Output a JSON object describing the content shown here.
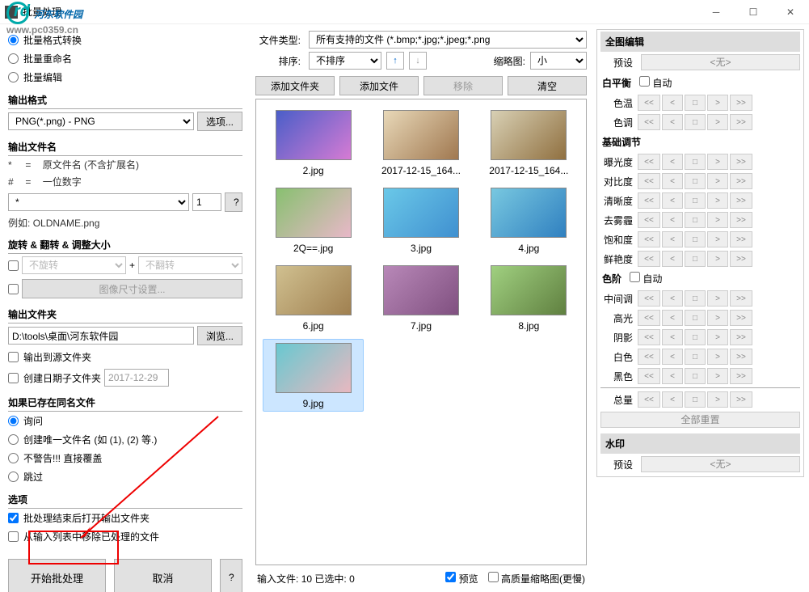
{
  "title": "批量处理",
  "watermark": {
    "main": "河东软件园",
    "sub": "www.pc0359.cn"
  },
  "left": {
    "mode": {
      "convert": "批量格式转换",
      "rename": "批量重命名",
      "edit": "批量编辑",
      "selected": "convert"
    },
    "outputFormat": {
      "title": "输出格式",
      "value": "PNG(*.png) - PNG",
      "optionsBtn": "选项..."
    },
    "outputName": {
      "title": "输出文件名",
      "hint1_sym": "*",
      "hint1_eq": "=",
      "hint1": "原文件名 (不含扩展名)",
      "hint2_sym": "#",
      "hint2_eq": "=",
      "hint2": "一位数字",
      "pattern": "*",
      "number": "1",
      "example_label": "例如:",
      "example": "OLDNAME.png"
    },
    "rotate": {
      "title": "旋转 & 翻转 & 调整大小",
      "rotateVal": "不旋转",
      "plus": "+",
      "flipVal": "不翻转",
      "sizeBtn": "图像尺寸设置..."
    },
    "outFolder": {
      "title": "输出文件夹",
      "path": "D:\\tools\\桌面\\河东软件园",
      "browse": "浏览...",
      "toSource": "输出到源文件夹",
      "dateFolder": "创建日期子文件夹",
      "dateVal": "2017-12-29"
    },
    "ifExists": {
      "title": "如果已存在同名文件",
      "ask": "询问",
      "unique": "创建唯一文件名 (如 (1), (2) 等.)",
      "overwrite": "不警告!!! 直接覆盖",
      "skip": "跳过"
    },
    "options": {
      "title": "选项",
      "openAfter": "批处理结束后打开输出文件夹",
      "removeDone": "从输入列表中移除已处理的文件"
    },
    "buttons": {
      "start": "开始批处理",
      "cancel": "取消",
      "help": "?"
    }
  },
  "mid": {
    "fileTypeLabel": "文件类型:",
    "fileTypeValue": "所有支持的文件 (*.bmp;*.jpg;*.jpeg;*.png",
    "sortLabel": "排序:",
    "sortValue": "不排序",
    "thumbLabel": "缩略图:",
    "thumbValue": "小",
    "btns": {
      "addFolder": "添加文件夹",
      "addFile": "添加文件",
      "remove": "移除",
      "clear": "清空"
    },
    "thumbs": [
      {
        "name": "2.jpg",
        "color1": "#4a5ec8",
        "color2": "#d67bd4"
      },
      {
        "name": "2017-12-15_164...",
        "color1": "#e8d8b8",
        "color2": "#a07850"
      },
      {
        "name": "2017-12-15_164...",
        "color1": "#d8d0b4",
        "color2": "#907040"
      },
      {
        "name": "2Q==.jpg",
        "color1": "#88c070",
        "color2": "#e8b8c8"
      },
      {
        "name": "3.jpg",
        "color1": "#6ac8e8",
        "color2": "#4090d0"
      },
      {
        "name": "4.jpg",
        "color1": "#78c8e0",
        "color2": "#3080c0"
      },
      {
        "name": "6.jpg",
        "color1": "#d0c090",
        "color2": "#a08050"
      },
      {
        "name": "7.jpg",
        "color1": "#b888b8",
        "color2": "#805080"
      },
      {
        "name": "8.jpg",
        "color1": "#a0d080",
        "color2": "#608040"
      },
      {
        "name": "9.jpg",
        "color1": "#68c8d0",
        "color2": "#e8b8c0",
        "selected": true
      }
    ],
    "status": {
      "inputLabel": "输入文件:",
      "inputCount": "10",
      "selLabel": "已选中:",
      "selCount": "0",
      "preview": "预览",
      "hq": "高质量缩略图(更慢)"
    }
  },
  "right": {
    "header": "全图编辑",
    "preset": "预设",
    "presetNone": "<无>",
    "wb": {
      "title": "白平衡",
      "auto": "自动",
      "temp": "色温",
      "tint": "色调"
    },
    "basic": {
      "title": "基础调节",
      "exposure": "曝光度",
      "contrast": "对比度",
      "clarity": "清晰度",
      "dehaze": "去雾霾",
      "saturation": "饱和度",
      "vibrance": "鲜艳度"
    },
    "levels": {
      "title": "色阶",
      "auto": "自动",
      "mid": "中间调",
      "high": "高光",
      "shadow": "阴影",
      "white": "白色",
      "black": "黑色"
    },
    "total": "总量",
    "resetAll": "全部重置",
    "watermark": "水印"
  },
  "adj_btns": {
    "ll": "<<",
    "l": "<",
    "m": "□",
    "r": ">",
    "rr": ">>"
  }
}
